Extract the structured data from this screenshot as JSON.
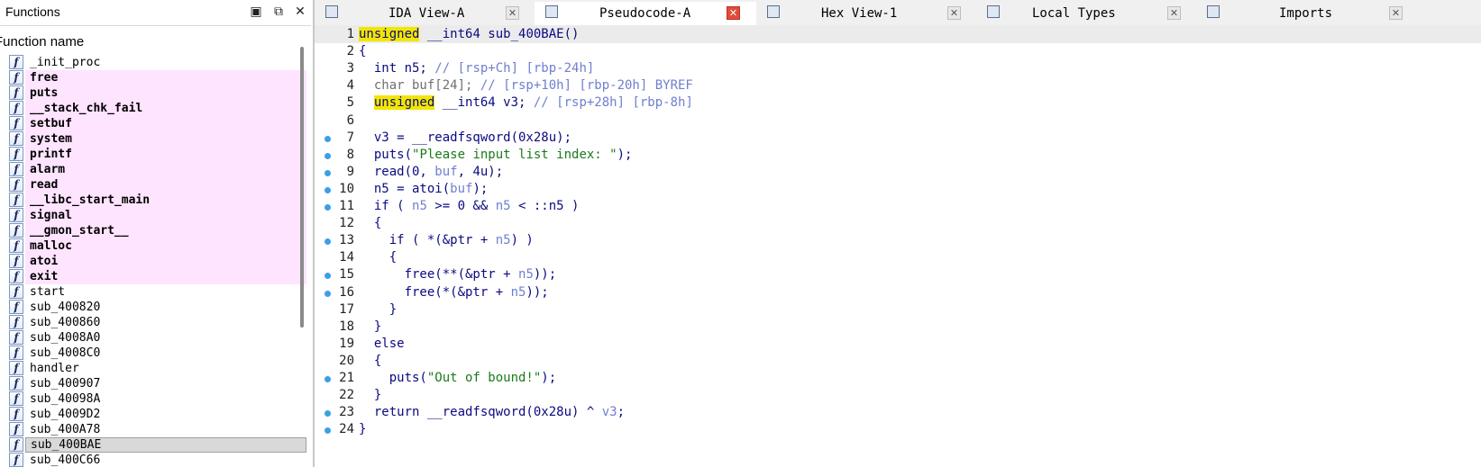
{
  "functions_panel": {
    "title": "Functions",
    "column_header": "Function name",
    "items": [
      {
        "name": "_init_proc",
        "lib": false
      },
      {
        "name": "free",
        "lib": true
      },
      {
        "name": "puts",
        "lib": true
      },
      {
        "name": "__stack_chk_fail",
        "lib": true
      },
      {
        "name": "setbuf",
        "lib": true
      },
      {
        "name": "system",
        "lib": true
      },
      {
        "name": "printf",
        "lib": true
      },
      {
        "name": "alarm",
        "lib": true
      },
      {
        "name": "read",
        "lib": true
      },
      {
        "name": "__libc_start_main",
        "lib": true
      },
      {
        "name": "signal",
        "lib": true
      },
      {
        "name": "__gmon_start__",
        "lib": true
      },
      {
        "name": "malloc",
        "lib": true
      },
      {
        "name": "atoi",
        "lib": true
      },
      {
        "name": "exit",
        "lib": true
      },
      {
        "name": "start",
        "lib": false
      },
      {
        "name": "sub_400820",
        "lib": false
      },
      {
        "name": "sub_400860",
        "lib": false
      },
      {
        "name": "sub_4008A0",
        "lib": false
      },
      {
        "name": "sub_4008C0",
        "lib": false
      },
      {
        "name": "handler",
        "lib": false
      },
      {
        "name": "sub_400907",
        "lib": false
      },
      {
        "name": "sub_40098A",
        "lib": false
      },
      {
        "name": "sub_4009D2",
        "lib": false
      },
      {
        "name": "sub_400A78",
        "lib": false
      },
      {
        "name": "sub_400BAE",
        "lib": false,
        "selected": true
      },
      {
        "name": "sub_400C66",
        "lib": false
      }
    ],
    "icon": "function-icon",
    "lib_highlight_color": "#ffe4ff"
  },
  "tabs": [
    {
      "label": "IDA View-A",
      "icon": "ida-view-icon",
      "active": false
    },
    {
      "label": "Pseudocode-A",
      "icon": "pseudocode-icon",
      "active": true
    },
    {
      "label": "Hex View-1",
      "icon": "hex-view-icon",
      "active": false
    },
    {
      "label": "Local Types",
      "icon": "local-types-icon",
      "active": false
    },
    {
      "label": "Imports",
      "icon": "imports-icon",
      "active": false
    }
  ],
  "code": {
    "lines": [
      {
        "n": "1",
        "dot": false,
        "segs": [
          [
            "kh",
            "unsigned"
          ],
          [
            "k",
            " __int64 sub_400BAE()"
          ]
        ]
      },
      {
        "n": "2",
        "dot": false,
        "segs": [
          [
            "k",
            "{"
          ]
        ]
      },
      {
        "n": "3",
        "dot": false,
        "segs": [
          [
            "k",
            "  int n5; "
          ],
          [
            "c",
            "// [rsp+Ch] [rbp-24h]"
          ]
        ]
      },
      {
        "n": "4",
        "dot": false,
        "segs": [
          [
            "g",
            "  char buf[24]; "
          ],
          [
            "c",
            "// [rsp+10h] [rbp-20h] BYREF"
          ]
        ]
      },
      {
        "n": "5",
        "dot": false,
        "segs": [
          [
            "k",
            "  "
          ],
          [
            "kh",
            "unsigned"
          ],
          [
            "k",
            " __int64 v3; "
          ],
          [
            "c",
            "// [rsp+28h] [rbp-8h]"
          ]
        ]
      },
      {
        "n": "6",
        "dot": false,
        "segs": []
      },
      {
        "n": "7",
        "dot": true,
        "segs": [
          [
            "k",
            "  v3 = __readfsqword(0x28u);"
          ]
        ]
      },
      {
        "n": "8",
        "dot": true,
        "segs": [
          [
            "k",
            "  puts("
          ],
          [
            "s",
            "\"Please input list index: \""
          ],
          [
            "k",
            ");"
          ]
        ]
      },
      {
        "n": "9",
        "dot": true,
        "segs": [
          [
            "k",
            "  read(0, "
          ],
          [
            "v",
            "buf"
          ],
          [
            "k",
            ", 4u);"
          ]
        ]
      },
      {
        "n": "10",
        "dot": true,
        "segs": [
          [
            "k",
            "  n5 = atoi("
          ],
          [
            "v",
            "buf"
          ],
          [
            "k",
            ");"
          ]
        ]
      },
      {
        "n": "11",
        "dot": true,
        "segs": [
          [
            "k",
            "  if ( "
          ],
          [
            "v",
            "n5"
          ],
          [
            "k",
            " >= 0 && "
          ],
          [
            "v",
            "n5"
          ],
          [
            "k",
            " < ::n5 )"
          ]
        ]
      },
      {
        "n": "12",
        "dot": false,
        "segs": [
          [
            "k",
            "  {"
          ]
        ]
      },
      {
        "n": "13",
        "dot": true,
        "segs": [
          [
            "k",
            "    if ( *(&ptr + "
          ],
          [
            "v",
            "n5"
          ],
          [
            "k",
            ") )"
          ]
        ]
      },
      {
        "n": "14",
        "dot": false,
        "segs": [
          [
            "k",
            "    {"
          ]
        ]
      },
      {
        "n": "15",
        "dot": true,
        "segs": [
          [
            "k",
            "      free(**(&ptr + "
          ],
          [
            "v",
            "n5"
          ],
          [
            "k",
            "));"
          ]
        ]
      },
      {
        "n": "16",
        "dot": true,
        "segs": [
          [
            "k",
            "      free(*(&ptr + "
          ],
          [
            "v",
            "n5"
          ],
          [
            "k",
            "));"
          ]
        ]
      },
      {
        "n": "17",
        "dot": false,
        "segs": [
          [
            "k",
            "    }"
          ]
        ]
      },
      {
        "n": "18",
        "dot": false,
        "segs": [
          [
            "k",
            "  }"
          ]
        ]
      },
      {
        "n": "19",
        "dot": false,
        "segs": [
          [
            "k",
            "  else"
          ]
        ]
      },
      {
        "n": "20",
        "dot": false,
        "segs": [
          [
            "k",
            "  {"
          ]
        ]
      },
      {
        "n": "21",
        "dot": true,
        "segs": [
          [
            "k",
            "    puts("
          ],
          [
            "s",
            "\"Out of bound!\""
          ],
          [
            "k",
            ");"
          ]
        ]
      },
      {
        "n": "22",
        "dot": false,
        "segs": [
          [
            "k",
            "  }"
          ]
        ]
      },
      {
        "n": "23",
        "dot": true,
        "segs": [
          [
            "k",
            "  return __readfsqword(0x28u) ^ "
          ],
          [
            "v",
            "v3"
          ],
          [
            "k",
            ";"
          ]
        ]
      },
      {
        "n": "24",
        "dot": true,
        "segs": [
          [
            "k",
            "}"
          ]
        ]
      }
    ]
  }
}
